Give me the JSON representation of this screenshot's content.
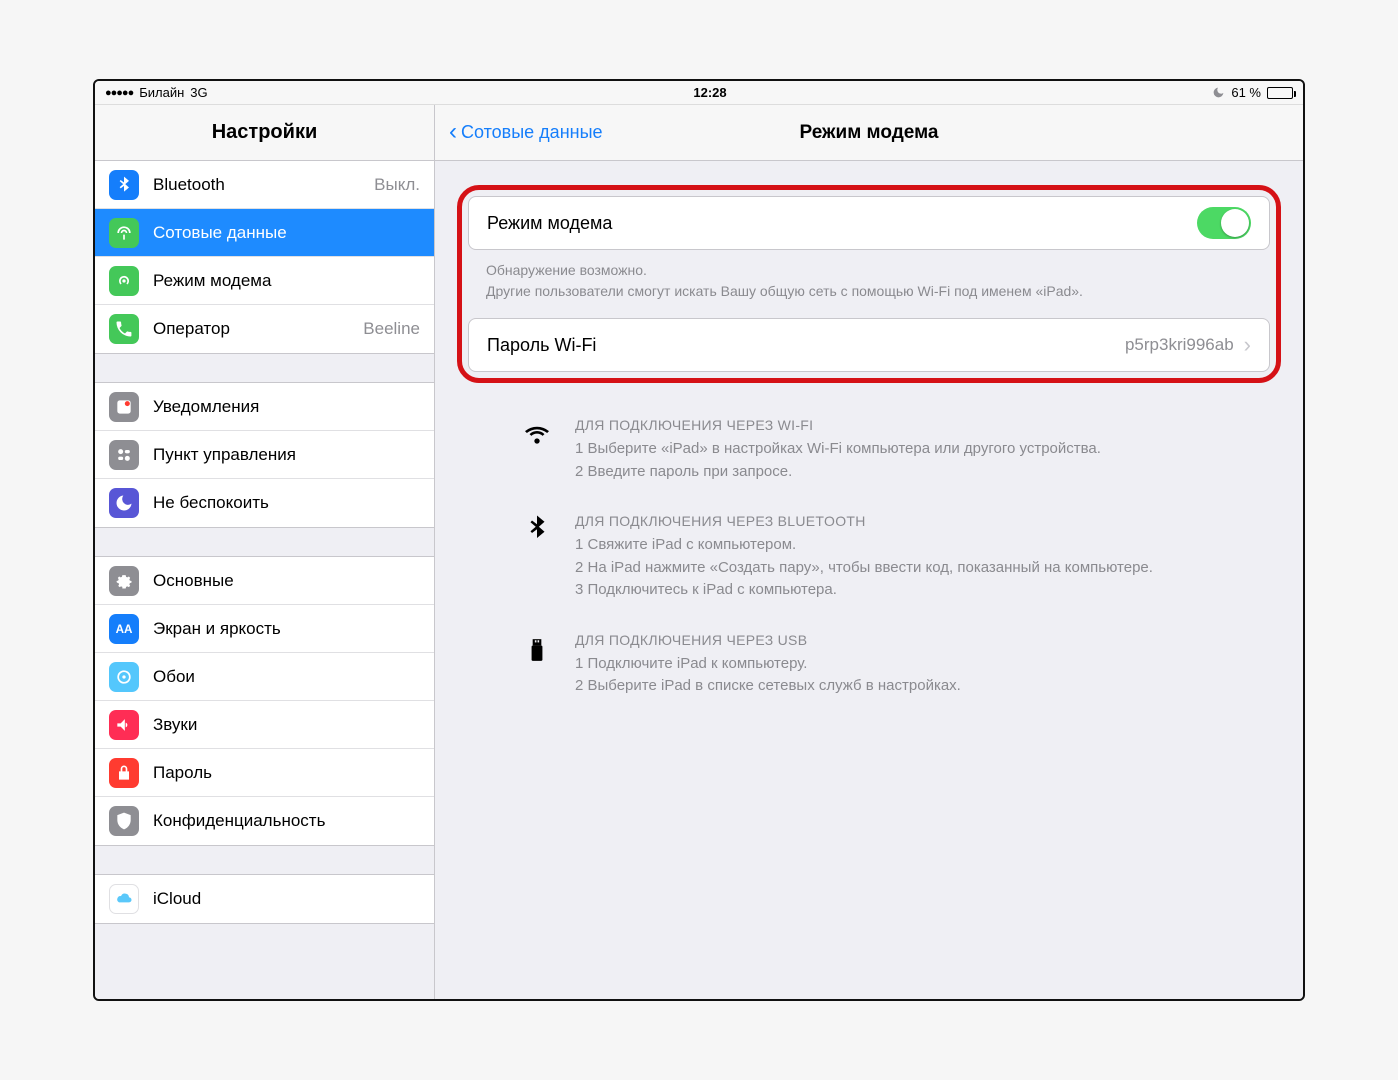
{
  "status": {
    "carrier": "Билайн",
    "network": "3G",
    "time": "12:28",
    "battery_pct": "61 %"
  },
  "sidebar": {
    "title": "Настройки",
    "items": [
      {
        "label": "Bluetooth",
        "value": "Выкл.",
        "icon": "bluetooth-icon",
        "color": "c-blue"
      },
      {
        "label": "Сотовые данные",
        "value": "",
        "icon": "cellular-icon",
        "color": "c-green",
        "selected": true
      },
      {
        "label": "Режим модема",
        "value": "",
        "icon": "hotspot-icon",
        "color": "c-green"
      },
      {
        "label": "Оператор",
        "value": "Beeline",
        "icon": "phone-icon",
        "color": "c-green"
      }
    ],
    "group2": [
      {
        "label": "Уведомления",
        "icon": "notifications-icon",
        "color": "c-gray"
      },
      {
        "label": "Пункт управления",
        "icon": "controlcenter-icon",
        "color": "c-gray"
      },
      {
        "label": "Не беспокоить",
        "icon": "dnd-icon",
        "color": "c-purple"
      }
    ],
    "group3": [
      {
        "label": "Основные",
        "icon": "general-icon",
        "color": "c-gray"
      },
      {
        "label": "Экран и яркость",
        "icon": "display-icon",
        "color": "c-bluea"
      },
      {
        "label": "Обои",
        "icon": "wallpaper-icon",
        "color": "c-cyan"
      },
      {
        "label": "Звуки",
        "icon": "sounds-icon",
        "color": "c-pink"
      },
      {
        "label": "Пароль",
        "icon": "passcode-icon",
        "color": "c-red"
      },
      {
        "label": "Конфиденциальность",
        "icon": "privacy-icon",
        "color": "c-gray"
      }
    ],
    "group4": [
      {
        "label": "iCloud",
        "icon": "icloud-icon",
        "color": "c-white"
      }
    ]
  },
  "content": {
    "back_label": "Сотовые данные",
    "title": "Режим модема",
    "hotspot_label": "Режим модема",
    "note_line1": "Обнаружение возможно.",
    "note_line2": "Другие пользователи смогут искать Вашу общую сеть с помощью Wi-Fi под именем «iPad».",
    "password_label": "Пароль Wi-Fi",
    "password_value": "p5rp3kri996ab",
    "inst_wifi_title": "ДЛЯ ПОДКЛЮЧЕНИЯ ЧЕРЕЗ WI-FI",
    "inst_wifi_1": "1 Выберите «iPad» в настройках Wi-Fi компьютера или другого устройства.",
    "inst_wifi_2": "2 Введите пароль при запросе.",
    "inst_bt_title": "ДЛЯ ПОДКЛЮЧЕНИЯ ЧЕРЕЗ BLUETOOTH",
    "inst_bt_1": "1 Свяжите iPad с компьютером.",
    "inst_bt_2": "2 На iPad нажмите «Создать пару», чтобы ввести код, показанный на компьютере.",
    "inst_bt_3": "3 Подключитесь к iPad с компьютера.",
    "inst_usb_title": "ДЛЯ ПОДКЛЮЧЕНИЯ ЧЕРЕЗ USB",
    "inst_usb_1": "1 Подключите iPad к компьютеру.",
    "inst_usb_2": "2 Выберите iPad в списке сетевых служб в настройках."
  }
}
